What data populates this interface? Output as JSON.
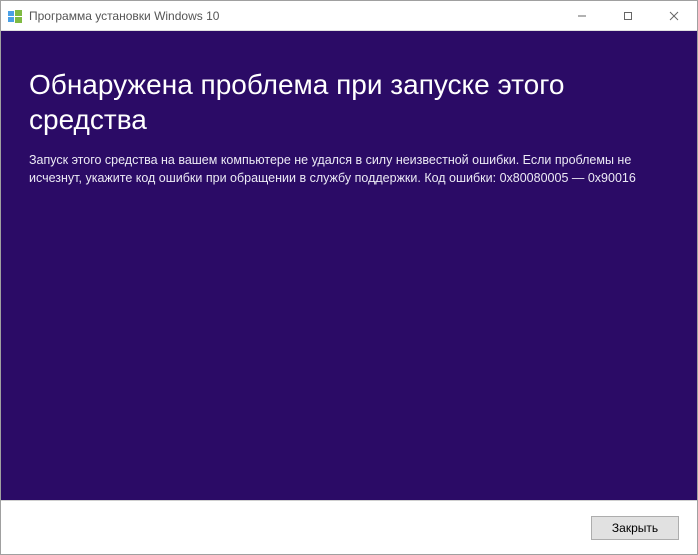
{
  "titlebar": {
    "title": "Программа установки Windows 10"
  },
  "content": {
    "heading": "Обнаружена проблема при запуске этого средства",
    "body": "Запуск этого средства на вашем компьютере не удался в силу неизвестной ошибки. Если проблемы не исчезнут, укажите код ошибки при обращении в службу поддержки. Код ошибки: 0x80080005 — 0x90016"
  },
  "footer": {
    "close_label": "Закрыть"
  }
}
